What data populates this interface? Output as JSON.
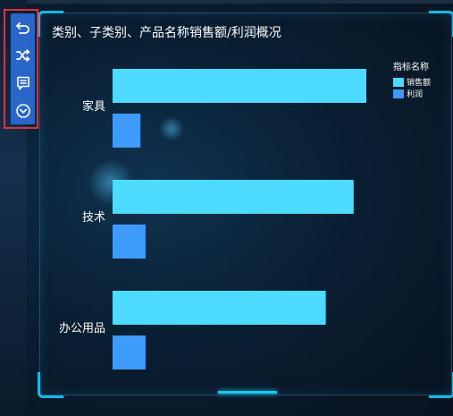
{
  "toolbar": {
    "buttons": [
      {
        "name": "undo-button",
        "icon": "undo-icon"
      },
      {
        "name": "shuffle-button",
        "icon": "shuffle-icon"
      },
      {
        "name": "comment-button",
        "icon": "comment-icon"
      },
      {
        "name": "expand-button",
        "icon": "chevron-down-circle-icon"
      }
    ]
  },
  "colors": {
    "sales": "#4ddcff",
    "profit": "#3e9bfa",
    "toolbar_bg": "#2a66c8",
    "highlight": "#e0323a",
    "frame_accent": "#18b8e8"
  },
  "chart_data": {
    "type": "bar",
    "orientation": "horizontal",
    "title": "类别、子类别、产品名称销售额/利润概况",
    "categories": [
      "家具",
      "技术",
      "办公用品"
    ],
    "series": [
      {
        "name": "销售额",
        "values": [
          100,
          95,
          84
        ]
      },
      {
        "name": "利润",
        "values": [
          11,
          13,
          13
        ]
      }
    ],
    "legend_title": "指标名称",
    "legend_position": "top-right",
    "xlim": [
      0,
      100
    ],
    "grid": false
  }
}
